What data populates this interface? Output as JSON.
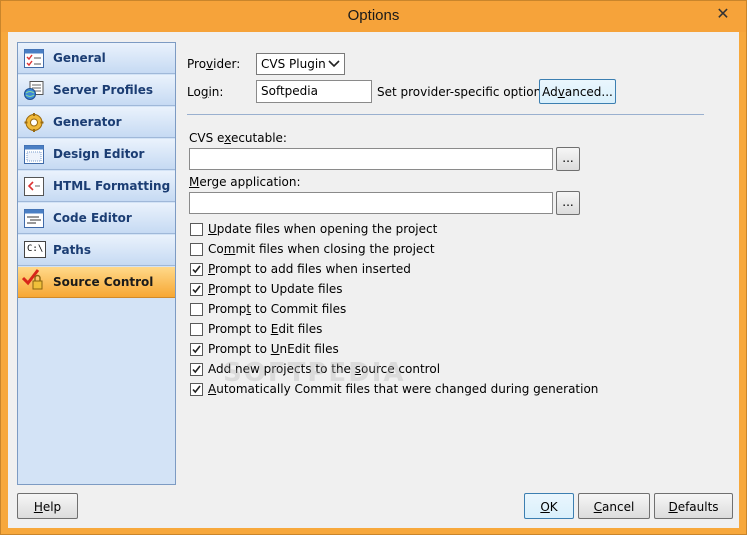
{
  "window": {
    "title": "Options",
    "close_glyph": "✕"
  },
  "sidebar": {
    "items": [
      {
        "label": "General",
        "icon": "general-icon"
      },
      {
        "label": "Server Profiles",
        "icon": "server-profiles-icon"
      },
      {
        "label": "Generator",
        "icon": "gear-icon"
      },
      {
        "label": "Design Editor",
        "icon": "design-editor-icon"
      },
      {
        "label": "HTML Formatting",
        "icon": "html-formatting-icon"
      },
      {
        "label": "Code Editor",
        "icon": "code-editor-icon"
      },
      {
        "label": "Paths",
        "icon": "paths-icon",
        "icon_text": "C:\\"
      },
      {
        "label": "Source Control",
        "icon": "source-control-icon",
        "active": true
      }
    ]
  },
  "form": {
    "provider_label_pre": "Pro",
    "provider_label_ul": "v",
    "provider_label_post": "ider:",
    "provider_value": "CVS Plugin",
    "login_label_pre": "Lo",
    "login_label_ul": "g",
    "login_label_post": "in:",
    "login_value": "Softpedia",
    "provider_options_label": "Set provider-specific options:",
    "advanced_button_pre": "Ad",
    "advanced_button_ul": "v",
    "advanced_button_post": "anced...",
    "cvs_exe_label_pre": "CVS e",
    "cvs_exe_label_ul": "x",
    "cvs_exe_label_post": "ecutable:",
    "cvs_exe_value": "",
    "merge_label_ul": "M",
    "merge_label_post": "erge application:",
    "merge_value": "",
    "browse_label": "..."
  },
  "checkboxes": [
    {
      "pre": "",
      "ul": "U",
      "post": "pdate files when opening the project",
      "checked": false
    },
    {
      "pre": "Co",
      "ul": "m",
      "post": "mit files when closing the project",
      "checked": false
    },
    {
      "pre": "",
      "ul": "P",
      "post": "rompt to add files when inserted",
      "checked": true
    },
    {
      "pre": "",
      "ul": "P",
      "post": "rompt to Update files",
      "checked": true
    },
    {
      "pre": "Promp",
      "ul": "t",
      "post": " to Commit files",
      "checked": false
    },
    {
      "pre": "Prompt to ",
      "ul": "E",
      "post": "dit files",
      "checked": false
    },
    {
      "pre": "Prompt to ",
      "ul": "U",
      "post": "nEdit files",
      "checked": true
    },
    {
      "pre": "Add new projects to the ",
      "ul": "s",
      "post": "ource control",
      "checked": true
    },
    {
      "pre": "",
      "ul": "A",
      "post": "utomatically Commit files that were changed during generation",
      "checked": true
    }
  ],
  "footer": {
    "help_ul": "H",
    "help_post": "elp",
    "ok_ul": "O",
    "ok_post": "K",
    "cancel_ul": "C",
    "cancel_post": "ancel",
    "defaults_ul": "D",
    "defaults_post": "efaults"
  },
  "watermark": "SOFTPEDIA"
}
